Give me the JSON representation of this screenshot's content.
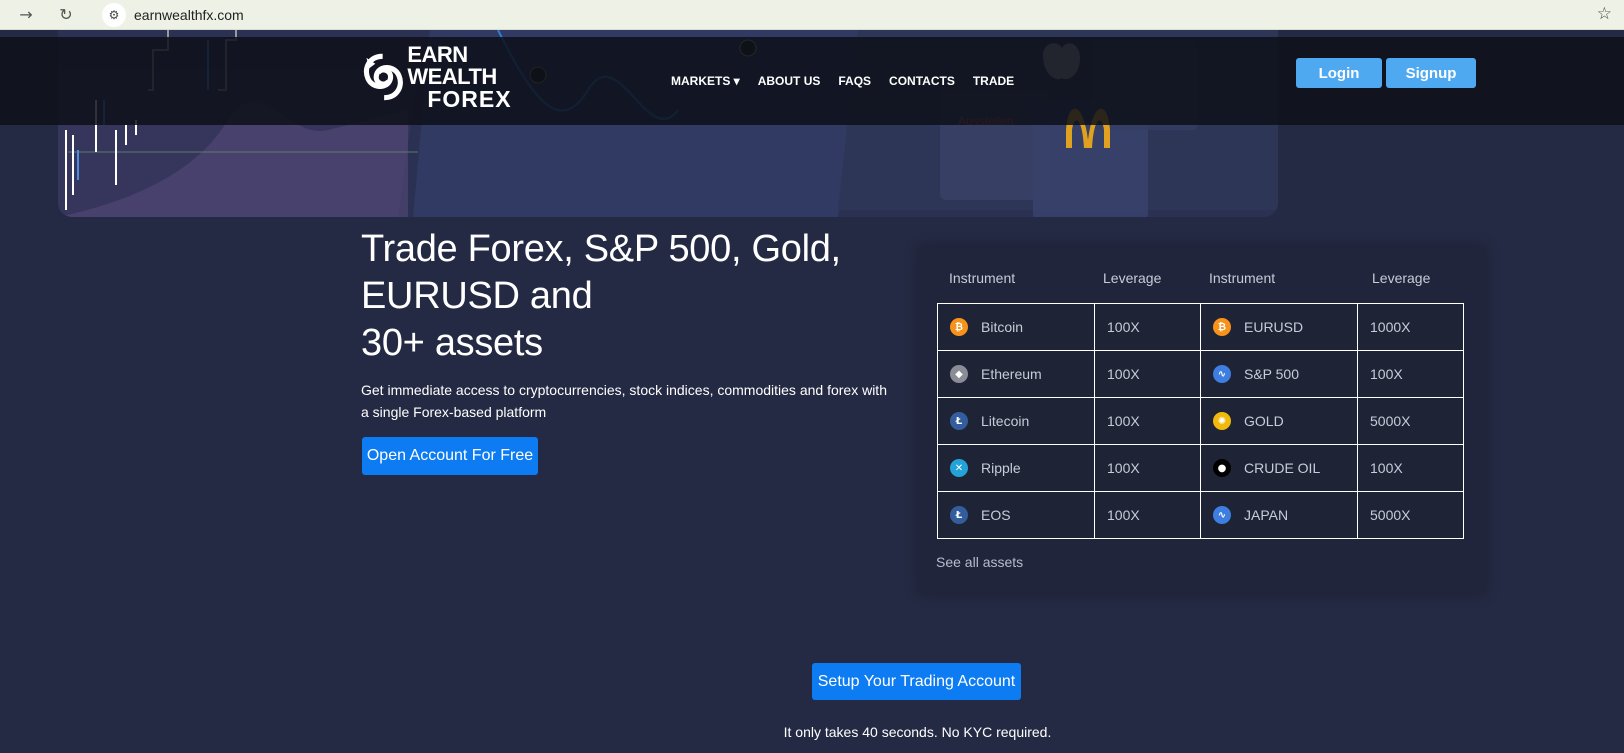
{
  "browser": {
    "url": "earnwealthfx.com"
  },
  "brand": {
    "line1": "EARN WEALTH",
    "line2": "FOREX"
  },
  "nav": {
    "markets": "MARKETS ▾",
    "about": "ABOUT US",
    "faqs": "FAQS",
    "contacts": "CONTACTS",
    "trade": "TRADE",
    "login": "Login",
    "signup": "Signup"
  },
  "hero": {
    "title": "Trade Forex, S&P 500, Gold,\nEURUSD and\n30+ assets",
    "subtitle": "Get immediate access to cryptocurrencies, stock indices, commodities and forex with a single Forex-based platform",
    "cta": "Open Account For Free"
  },
  "assets": {
    "headers": [
      "Instrument",
      "Leverage",
      "Instrument",
      "Leverage"
    ],
    "rows": [
      {
        "left": {
          "name": "Bitcoin",
          "lev": "100X",
          "icon": "bitcoin-icon",
          "color": "#f7931a",
          "glyph": "₿"
        },
        "right": {
          "name": "EURUSD",
          "lev": "1000X",
          "icon": "bitcoin-icon",
          "color": "#f7931a",
          "glyph": "₿"
        }
      },
      {
        "left": {
          "name": "Ethereum",
          "lev": "100X",
          "icon": "ethereum-icon",
          "color": "#8a8d95",
          "glyph": "◆"
        },
        "right": {
          "name": "S&P 500",
          "lev": "100X",
          "icon": "trend-chart-icon",
          "color": "#3d7ee0",
          "glyph": "∿"
        }
      },
      {
        "left": {
          "name": "Litecoin",
          "lev": "100X",
          "icon": "litecoin-icon",
          "color": "#345d9d",
          "glyph": "Ł"
        },
        "right": {
          "name": "GOLD",
          "lev": "5000X",
          "icon": "gold-icon",
          "color": "#f0b90b",
          "glyph": "✺"
        }
      },
      {
        "left": {
          "name": "Ripple",
          "lev": "100X",
          "icon": "ripple-icon",
          "color": "#23a3d8",
          "glyph": "✕"
        },
        "right": {
          "name": "CRUDE OIL",
          "lev": "100X",
          "icon": "oil-drop-icon",
          "color": "#000000",
          "glyph": "●"
        }
      },
      {
        "left": {
          "name": "EOS",
          "lev": "100X",
          "icon": "eos-icon",
          "color": "#345d9d",
          "glyph": "Ł"
        },
        "right": {
          "name": "JAPAN",
          "lev": "5000X",
          "icon": "trend-chart-icon",
          "color": "#3d7ee0",
          "glyph": "∿"
        }
      }
    ],
    "see_all": "See all assets"
  },
  "setup": {
    "cta": "Setup Your Trading Account",
    "note": "It only takes 40 seconds. No KYC required."
  }
}
